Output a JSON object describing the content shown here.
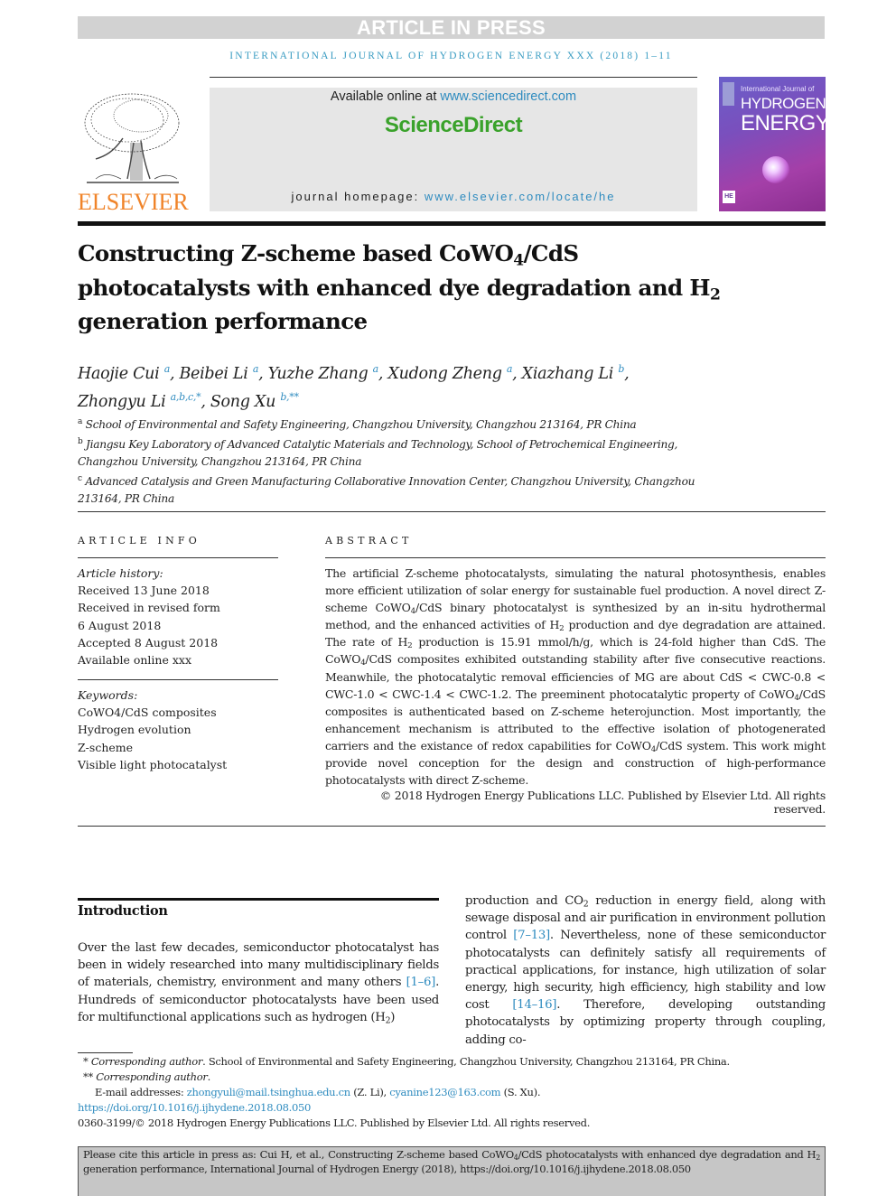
{
  "banner": {
    "status": "ARTICLE IN PRESS"
  },
  "journal_line": "INTERNATIONAL JOURNAL OF HYDROGEN ENERGY XXX (2018) 1–11",
  "header": {
    "publisher": "ELSEVIER",
    "available_prefix": "Available online at ",
    "available_url": "www.sciencedirect.com",
    "brand": "ScienceDirect",
    "homepage_prefix": "journal homepage: ",
    "homepage_url": "www.elsevier.com/locate/he",
    "cover": {
      "line1": "International Journal of",
      "line2": "HYDROGEN",
      "line3": "ENERGY",
      "badge": "HE"
    },
    "colors": {
      "brand_green": "#3aa22b",
      "elsevier_orange": "#f0842a",
      "link_blue": "#2e8bbf"
    }
  },
  "article": {
    "title_1": "Constructing Z-scheme based CoWO",
    "title_sub4": "4",
    "title_2": "/CdS photocatalysts with enhanced dye degradation and H",
    "title_sub2": "2",
    "title_3": " generation performance",
    "authors": [
      {
        "name": "Haojie Cui",
        "aff": "a"
      },
      {
        "name": "Beibei Li",
        "aff": "a"
      },
      {
        "name": "Yuzhe Zhang",
        "aff": "a"
      },
      {
        "name": "Xudong Zheng",
        "aff": "a"
      },
      {
        "name": "Xiazhang Li",
        "aff": "b"
      },
      {
        "name": "Zhongyu Li",
        "aff": "a,b,c,*"
      },
      {
        "name": "Song Xu",
        "aff": "b,**"
      }
    ],
    "affiliations": [
      {
        "key": "a",
        "text": "School of Environmental and Safety Engineering, Changzhou University, Changzhou 213164, PR China"
      },
      {
        "key": "b",
        "text": "Jiangsu Key Laboratory of Advanced Catalytic Materials and Technology, School of Petrochemical Engineering, Changzhou University, Changzhou 213164, PR China"
      },
      {
        "key": "c",
        "text": "Advanced Catalysis and Green Manufacturing Collaborative Innovation Center, Changzhou University, Changzhou 213164, PR China"
      }
    ]
  },
  "article_info": {
    "label": "ARTICLE INFO",
    "history_label": "Article history:",
    "history": [
      "Received 13 June 2018",
      "Received in revised form",
      "6 August 2018",
      "Accepted 8 August 2018",
      "Available online xxx"
    ],
    "keywords_label": "Keywords:",
    "keywords": [
      "CoWO4/CdS composites",
      "Hydrogen evolution",
      "Z-scheme",
      "Visible light photocatalyst"
    ]
  },
  "abstract": {
    "label": "ABSTRACT",
    "p1": "The artificial Z-scheme photocatalysts, simulating the natural photosynthesis, enables more efficient utilization of solar energy for sustainable fuel production. A novel direct Z-scheme CoWO",
    "p2": "/CdS binary photocatalyst is synthesized by an in-situ hydrothermal method, and the enhanced activities of H",
    "p3": " production and dye degradation are attained. The rate of H",
    "p4": " production is 15.91 mmol/h/g, which is 24-fold higher than CdS. The CoWO",
    "p5": "/CdS composites exhibited outstanding stability after five consecutive reactions. Meanwhile, the photocatalytic removal efficiencies of MG are about CdS < CWC-0.8 < CWC-1.0 < CWC-1.4 < CWC-1.2. The preeminent photocatalytic property of CoWO",
    "p6": "/CdS composites is authenticated based on Z-scheme heterojunction. Most importantly, the enhancement mechanism is attributed to the effective isolation of photogenerated carriers and the existance of redox capabilities for CoWO",
    "p7": "/CdS system. This work might provide novel conception for the design and construction of high-performance photocatalysts with direct Z-scheme.",
    "copyright": "© 2018 Hydrogen Energy Publications LLC. Published by Elsevier Ltd. All rights reserved."
  },
  "introduction": {
    "heading": "Introduction",
    "c1a": "Over the last few decades, semiconductor photocatalyst has been in widely researched into many multidisciplinary fields of materials, chemistry, environment and many others ",
    "ref1": "[1–6]",
    "c1b": ". Hundreds of semiconductor photocatalysts have been used for multifunctional applications such as hydrogen (H",
    "c1c": ")",
    "c2a": "production and CO",
    "c2b": " reduction in energy field, along with sewage disposal and air purification in environment pollution control ",
    "ref2": "[7–13]",
    "c2c": ". Nevertheless, none of these semiconductor photocatalysts can definitely satisfy all requirements of practical applications, for instance, high utilization of solar energy, high security, high efficiency, high stability and low cost ",
    "ref3": "[14–16]",
    "c2d": ". Therefore, developing outstanding photocatalysts by optimizing property through coupling, adding co-"
  },
  "footnotes": {
    "star1_label": "Corresponding author",
    "star1_text": ". School of Environmental and Safety Engineering, Changzhou University, Changzhou 213164, PR China.",
    "star2_label": "Corresponding author",
    "email_prefix": "E-mail addresses: ",
    "email1": "zhongyuli@mail.tsinghua.edu.cn",
    "email1_who": " (Z. Li), ",
    "email2": "cyanine123@163.com",
    "email2_who": " (S. Xu).",
    "doi": "https://doi.org/10.1016/j.ijhydene.2018.08.050",
    "issn_line": "0360-3199/© 2018 Hydrogen Energy Publications LLC. Published by Elsevier Ltd. All rights reserved."
  },
  "cite_box": {
    "a": "Please cite this article in press as: Cui H, et al., Constructing Z-scheme based CoWO",
    "b": "/CdS photocatalysts with enhanced dye degradation and H",
    "c": " generation performance, International Journal of Hydrogen Energy (2018), https://doi.org/10.1016/j.ijhydene.2018.08.050"
  }
}
